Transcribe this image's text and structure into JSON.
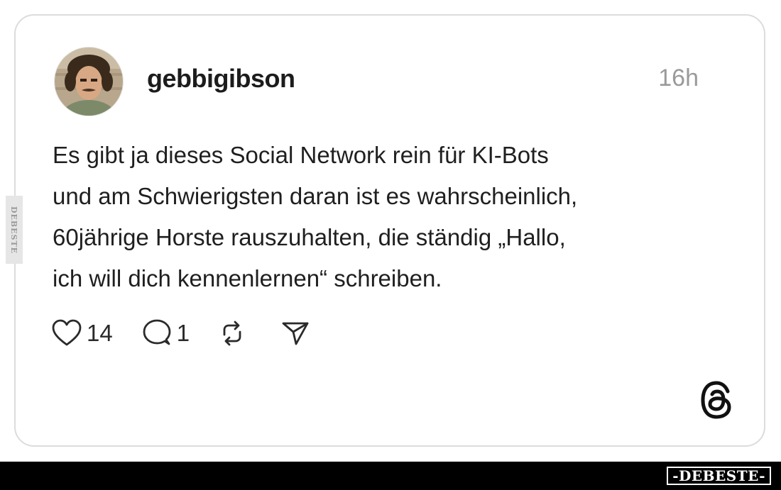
{
  "post": {
    "username": "gebbigibson",
    "time": "16h",
    "text": "Es gibt ja dieses Social Network rein für KI-Bots\nund am Schwierigsten daran ist es wahrscheinlich,\n60jährige Horste rauszuhalten, die ständig „Hallo,\nich will dich kennenlernen“ schreiben."
  },
  "actions": {
    "likes": "14",
    "replies": "1"
  },
  "icons": {
    "like": "heart-icon",
    "reply": "speech-bubble-icon",
    "repost": "repost-icon",
    "share": "send-icon",
    "brand": "threads-logo-icon"
  },
  "watermark": {
    "side": "DEBESTE",
    "footer": "-DEBESTE-"
  },
  "colors": {
    "text": "#1f1f1f",
    "muted": "#9a9a9a",
    "border": "#dcdcdc",
    "footer": "#000000"
  }
}
